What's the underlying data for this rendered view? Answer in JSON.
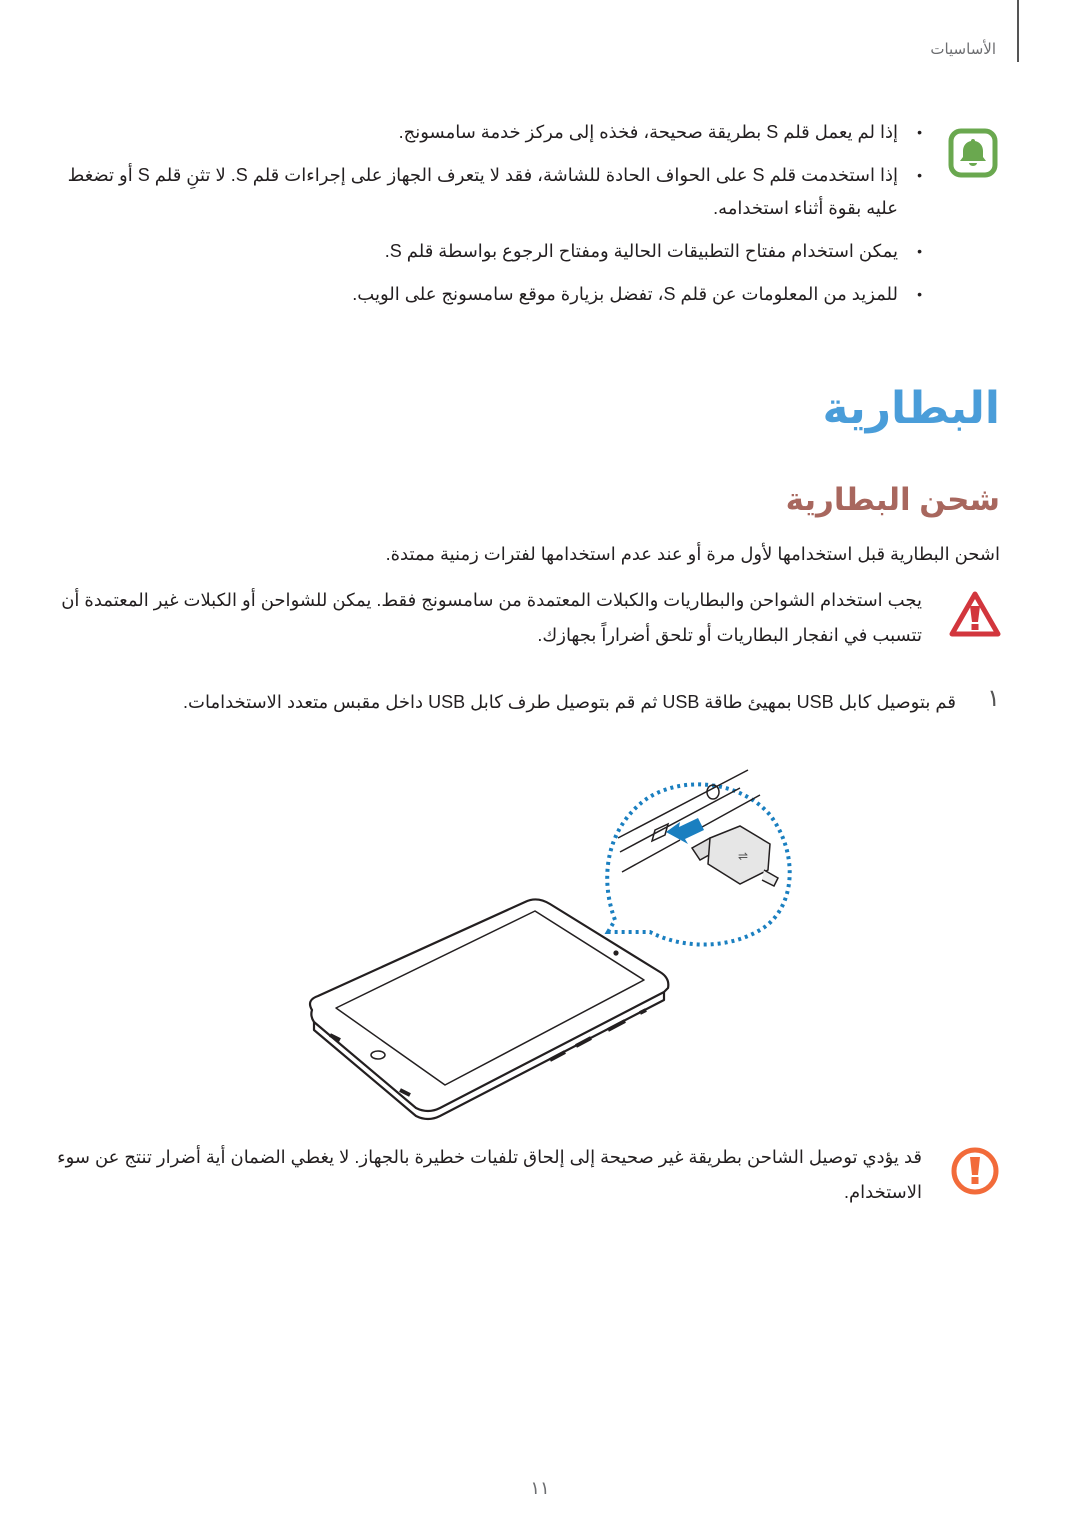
{
  "header": {
    "section_label": "الأساسيات"
  },
  "pen_notes": {
    "icon": "bell-notice-icon",
    "icon_color": "#6aa84f",
    "bullets": [
      "إذا لم يعمل قلم S بطريقة صحيحة، فخذه إلى مركز خدمة سامسونج.",
      "إذا استخدمت قلم S على الحواف الحادة للشاشة، فقد لا يتعرف الجهاز على إجراءات قلم S. لا تثنِ قلم S أو تضغط عليه بقوة أثناء استخدامه.",
      "يمكن استخدام مفتاح التطبيقات الحالية ومفتاح الرجوع بواسطة قلم S.",
      "للمزيد من المعلومات عن قلم S، تفضل بزيارة موقع سامسونج على الويب."
    ]
  },
  "section": {
    "title": "البطارية",
    "title_color": "#4a9dd9",
    "subtitle": "شحن البطارية",
    "subtitle_color": "#a8675e",
    "intro": "اشحن البطارية قبل استخدامها لأول مرة أو عند عدم استخدامها لفترات زمنية ممتدة."
  },
  "caution": {
    "icon": "caution-triangle-icon",
    "icon_color": "#d2363d",
    "text": "يجب استخدام الشواحن والبطاريات والكبلات المعتمدة من سامسونج فقط. يمكن للشواحن أو الكبلات غير المعتمدة أن تتسبب في انفجار البطاريات أو تلحق أضراراً بجهازك."
  },
  "steps": [
    {
      "number": "١",
      "text": "قم بتوصيل كابل USB بمهيئ طاقة USB ثم قم بتوصيل طرف كابل USB داخل مقبس متعدد الاستخدامات."
    }
  ],
  "illustration": {
    "description": "tablet-usb-charging-illustration",
    "callout_color": "#1a7fc0",
    "arrow_color": "#1a7fc0"
  },
  "warning": {
    "icon": "exclamation-circle-icon",
    "icon_color": "#f26b3a",
    "text": "قد يؤدي توصيل الشاحن بطريقة غير صحيحة إلى إلحاق تلفيات خطيرة بالجهاز. لا يغطي الضمان أية أضرار تنتج عن سوء الاستخدام."
  },
  "footer": {
    "page_number": "١١"
  }
}
